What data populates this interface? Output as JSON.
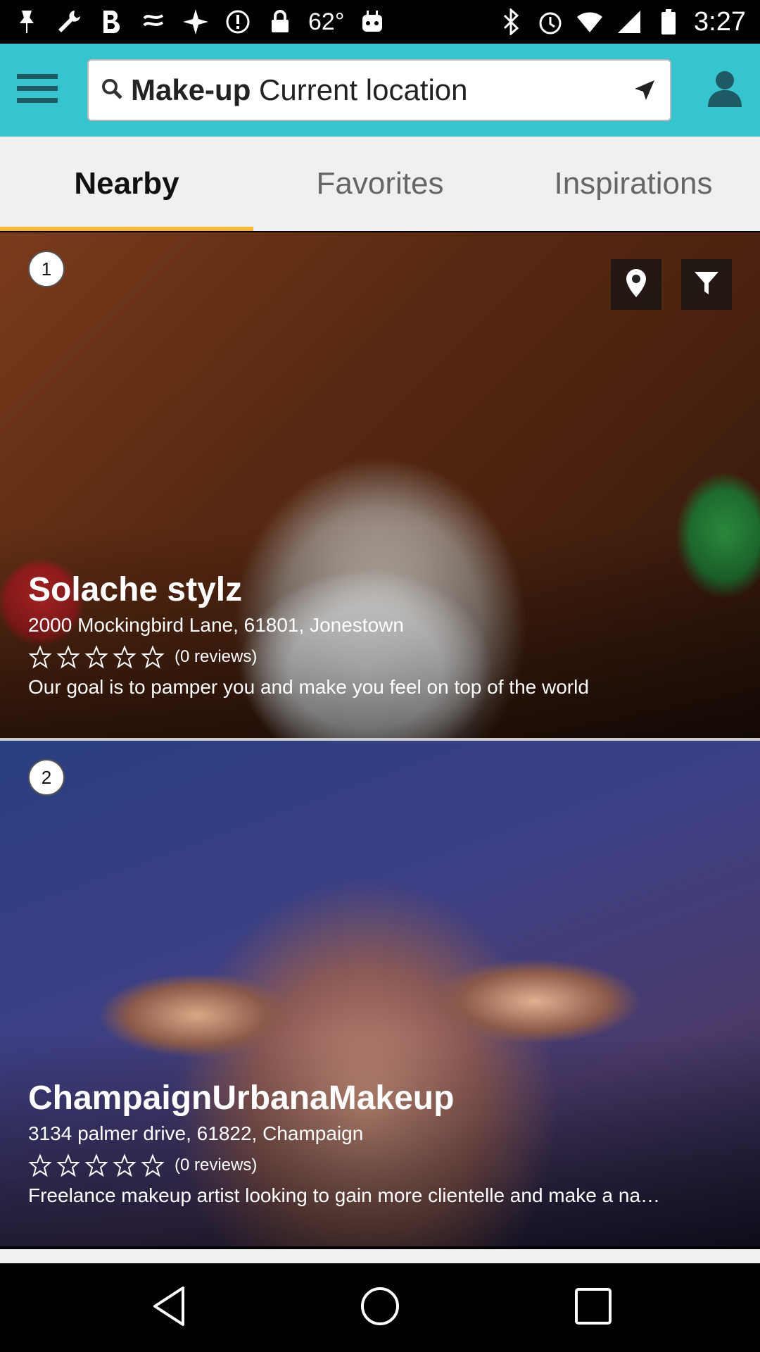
{
  "status_bar": {
    "temperature": "62°",
    "time": "3:27",
    "icons": [
      "pin-icon",
      "wrench-icon",
      "bold-icon",
      "swipe-icon",
      "fake-gps-icon",
      "info-icon",
      "lock-icon",
      "android-icon",
      "bluetooth-icon",
      "alarm-icon",
      "wifi-icon",
      "signal-icon",
      "battery-icon"
    ]
  },
  "top_bar": {
    "accent_color": "#36c5cf",
    "search_category": "Make-up",
    "search_location": "Current location"
  },
  "tabs": [
    {
      "label": "Nearby",
      "active": true
    },
    {
      "label": "Favorites",
      "active": false
    },
    {
      "label": "Inspirations",
      "active": false
    }
  ],
  "listings": [
    {
      "rank": "1",
      "name": "Solache stylz",
      "address": "2000 Mockingbird Lane, 61801, Jonestown",
      "rating": 0,
      "max_rating": 5,
      "reviews": "(0 reviews)",
      "description": "Our goal is to pamper you and make you feel on top of the world"
    },
    {
      "rank": "2",
      "name": "ChampaignUrbanaMakeup",
      "address": "3134 palmer drive, 61822, Champaign",
      "rating": 0,
      "max_rating": 5,
      "reviews": "(0 reviews)",
      "description": "Freelance makeup artist looking to gain more clientelle and make a na…"
    }
  ],
  "nav_bar": {
    "icons": [
      "back-icon",
      "home-icon",
      "recents-icon"
    ]
  }
}
